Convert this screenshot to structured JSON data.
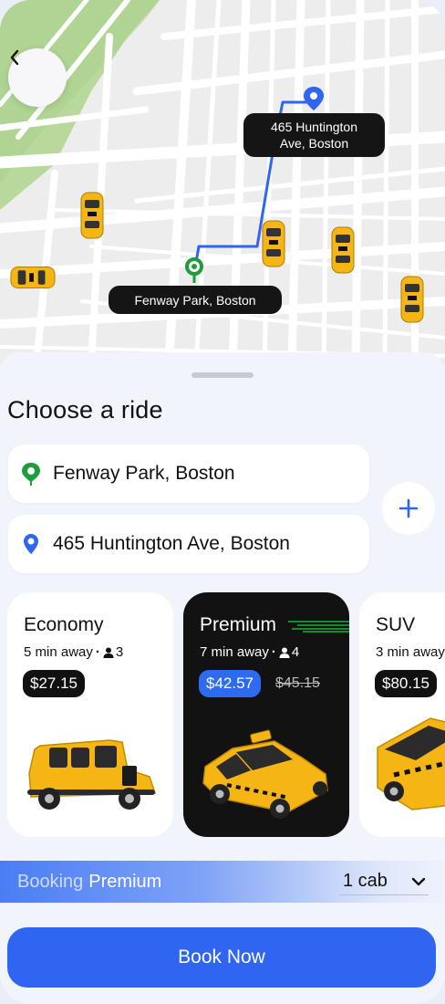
{
  "map": {
    "origin_label": "Fenway Park, Boston",
    "destination_label_line1": "465 Huntington",
    "destination_label_line2": "Ave, Boston",
    "route_color": "#2f65f0",
    "origin_pin_color": "#1f9d3c",
    "destination_pin_color": "#2f65f0"
  },
  "sheet": {
    "title": "Choose a ride",
    "from_value": "Fenway Park, Boston",
    "to_value": "465 Huntington Ave, Boston"
  },
  "rides": [
    {
      "name": "Economy",
      "eta": "5 min away",
      "seats": "3",
      "price": "$27.15",
      "old_price": "",
      "selected": false
    },
    {
      "name": "Premium",
      "eta": "7 min away",
      "seats": "4",
      "price": "$42.57",
      "old_price": "$45.15",
      "selected": true
    },
    {
      "name": "SUV",
      "eta": "3 min away",
      "seats": "",
      "price": "$80.15",
      "old_price": "",
      "selected": false
    }
  ],
  "booking": {
    "prefix": "Booking",
    "tier": "Premium",
    "cab_count": "1 cab"
  },
  "cta": {
    "book_label": "Book Now"
  },
  "colors": {
    "accent": "#2f65f0",
    "dark_card": "#121212",
    "taxi_yellow": "#f5b514"
  }
}
